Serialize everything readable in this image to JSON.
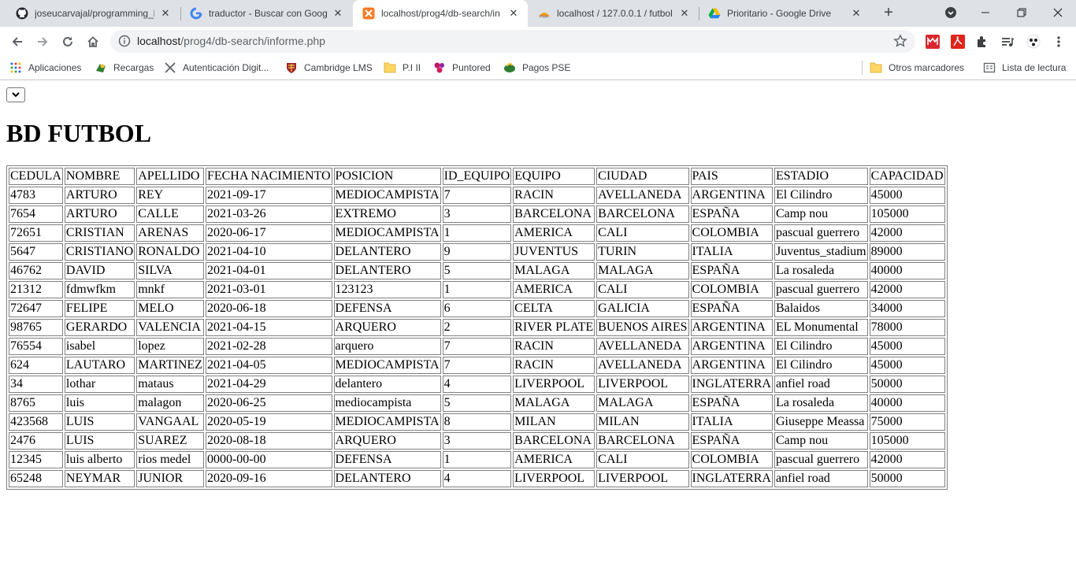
{
  "browser": {
    "tabs": [
      {
        "title": "joseucarvajal/programming_l",
        "icon": "github-icon"
      },
      {
        "title": "traductor - Buscar con Googl",
        "icon": "google-icon"
      },
      {
        "title": "localhost/prog4/db-search/in",
        "icon": "xampp-icon"
      },
      {
        "title": "localhost / 127.0.0.1 / futbol /",
        "icon": "phpmyadmin-icon"
      },
      {
        "title": "Prioritario - Google Drive",
        "icon": "google-drive-icon"
      }
    ],
    "active_tab": 2,
    "address": {
      "host": "localhost",
      "path": "/prog4/db-search/informe.php"
    },
    "bookmarks": [
      {
        "label": "Aplicaciones"
      },
      {
        "label": "Recargas"
      },
      {
        "label": "Autenticación Digit..."
      },
      {
        "label": "Cambridge LMS"
      },
      {
        "label": "P.I II"
      },
      {
        "label": "Puntored"
      },
      {
        "label": "Pagos PSE"
      }
    ],
    "other_bookmarks": "Otros marcadores",
    "reading_list": "Lista de lectura"
  },
  "page": {
    "heading": "BD FUTBOL",
    "table": {
      "headers": [
        "CEDULA",
        "NOMBRE",
        "APELLIDO",
        "FECHA NACIMIENTO",
        "POSICION",
        "ID_EQUIPO",
        "EQUIPO",
        "CIUDAD",
        "PAIS",
        "ESTADIO",
        "CAPACIDAD"
      ],
      "rows": [
        [
          "4783",
          "ARTURO",
          "REY",
          "2021-09-17",
          "MEDIOCAMPISTA",
          "7",
          "RACIN",
          "AVELLANEDA",
          "ARGENTINA",
          "El Cilindro",
          "45000"
        ],
        [
          "7654",
          "ARTURO",
          "CALLE",
          "2021-03-26",
          "EXTREMO",
          "3",
          "BARCELONA",
          "BARCELONA",
          "ESPAÑA",
          "Camp nou",
          "105000"
        ],
        [
          "72651",
          "CRISTIAN",
          "ARENAS",
          "2020-06-17",
          "MEDIOCAMPISTA",
          "1",
          "AMERICA",
          "CALI",
          "COLOMBIA",
          "pascual guerrero",
          "42000"
        ],
        [
          "5647",
          "CRISTIANO",
          "RONALDO",
          "2021-04-10",
          "DELANTERO",
          "9",
          "JUVENTUS",
          "TURIN",
          "ITALIA",
          "Juventus_stadium",
          "89000"
        ],
        [
          "46762",
          "DAVID",
          "SILVA",
          "2021-04-01",
          "DELANTERO",
          "5",
          "MALAGA",
          "MALAGA",
          "ESPAÑA",
          "La rosaleda",
          "40000"
        ],
        [
          "21312",
          "fdmwfkm",
          "mnkf",
          "2021-03-01",
          "123123",
          "1",
          "AMERICA",
          "CALI",
          "COLOMBIA",
          "pascual guerrero",
          "42000"
        ],
        [
          "72647",
          "FELIPE",
          "MELO",
          "2020-06-18",
          "DEFENSA",
          "6",
          "CELTA",
          "GALICIA",
          "ESPAÑA",
          "Balaidos",
          "34000"
        ],
        [
          "98765",
          "GERARDO",
          "VALENCIA",
          "2021-04-15",
          "ARQUERO",
          "2",
          "RIVER PLATE",
          "BUENOS AIRES",
          "ARGENTINA",
          "EL Monumental",
          "78000"
        ],
        [
          "76554",
          "isabel",
          "lopez",
          "2021-02-28",
          "arquero",
          "7",
          "RACIN",
          "AVELLANEDA",
          "ARGENTINA",
          "El Cilindro",
          "45000"
        ],
        [
          "624",
          "LAUTARO",
          "MARTINEZ",
          "2021-04-05",
          "MEDIOCAMPISTA",
          "7",
          "RACIN",
          "AVELLANEDA",
          "ARGENTINA",
          "El Cilindro",
          "45000"
        ],
        [
          "34",
          "lothar",
          "mataus",
          "2021-04-29",
          "delantero",
          "4",
          "LIVERPOOL",
          "LIVERPOOL",
          "INGLATERRA",
          "anfiel road",
          "50000"
        ],
        [
          "8765",
          "luis",
          "malagon",
          "2020-06-25",
          "mediocampista",
          "5",
          "MALAGA",
          "MALAGA",
          "ESPAÑA",
          "La rosaleda",
          "40000"
        ],
        [
          "423568",
          "LUIS",
          "VANGAAL",
          "2020-05-19",
          "MEDIOCAMPISTA",
          "8",
          "MILAN",
          "MILAN",
          "ITALIA",
          "Giuseppe Meassa",
          "75000"
        ],
        [
          "2476",
          "LUIS",
          "SUAREZ",
          "2020-08-18",
          "ARQUERO",
          "3",
          "BARCELONA",
          "BARCELONA",
          "ESPAÑA",
          "Camp nou",
          "105000"
        ],
        [
          "12345",
          "luis alberto",
          "rios medel",
          "0000-00-00",
          "DEFENSA",
          "1",
          "AMERICA",
          "CALI",
          "COLOMBIA",
          "pascual guerrero",
          "42000"
        ],
        [
          "65248",
          "NEYMAR",
          "JUNIOR",
          "2020-09-16",
          "DELANTERO",
          "4",
          "LIVERPOOL",
          "LIVERPOOL",
          "INGLATERRA",
          "anfiel road",
          "50000"
        ]
      ]
    }
  }
}
